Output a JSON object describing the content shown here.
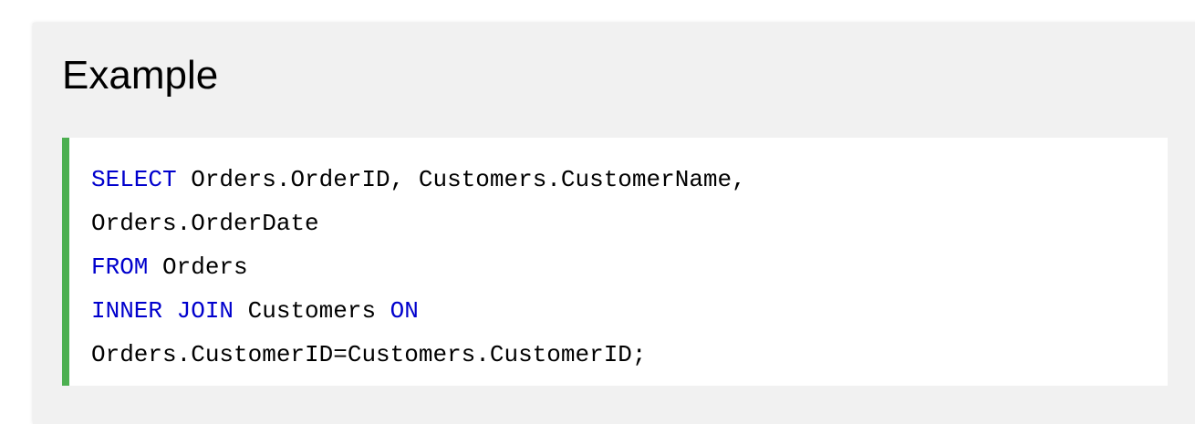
{
  "example": {
    "title": "Example"
  },
  "code": {
    "line1": {
      "kw": "SELECT",
      "rest": " Orders.OrderID, Customers.CustomerName,"
    },
    "line2": {
      "rest": "Orders.OrderDate"
    },
    "line3": {
      "kw": "FROM",
      "rest": " Orders"
    },
    "line4": {
      "kw1": "INNER JOIN",
      "mid": " Customers ",
      "kw2": "ON"
    },
    "line5": {
      "rest": "Orders.CustomerID=Customers.CustomerID;"
    }
  },
  "colors": {
    "panel_background": "#f1f1f1",
    "code_background": "#ffffff",
    "accent_border": "#4caf50",
    "sql_keyword": "#0000cd",
    "text": "#000000"
  }
}
